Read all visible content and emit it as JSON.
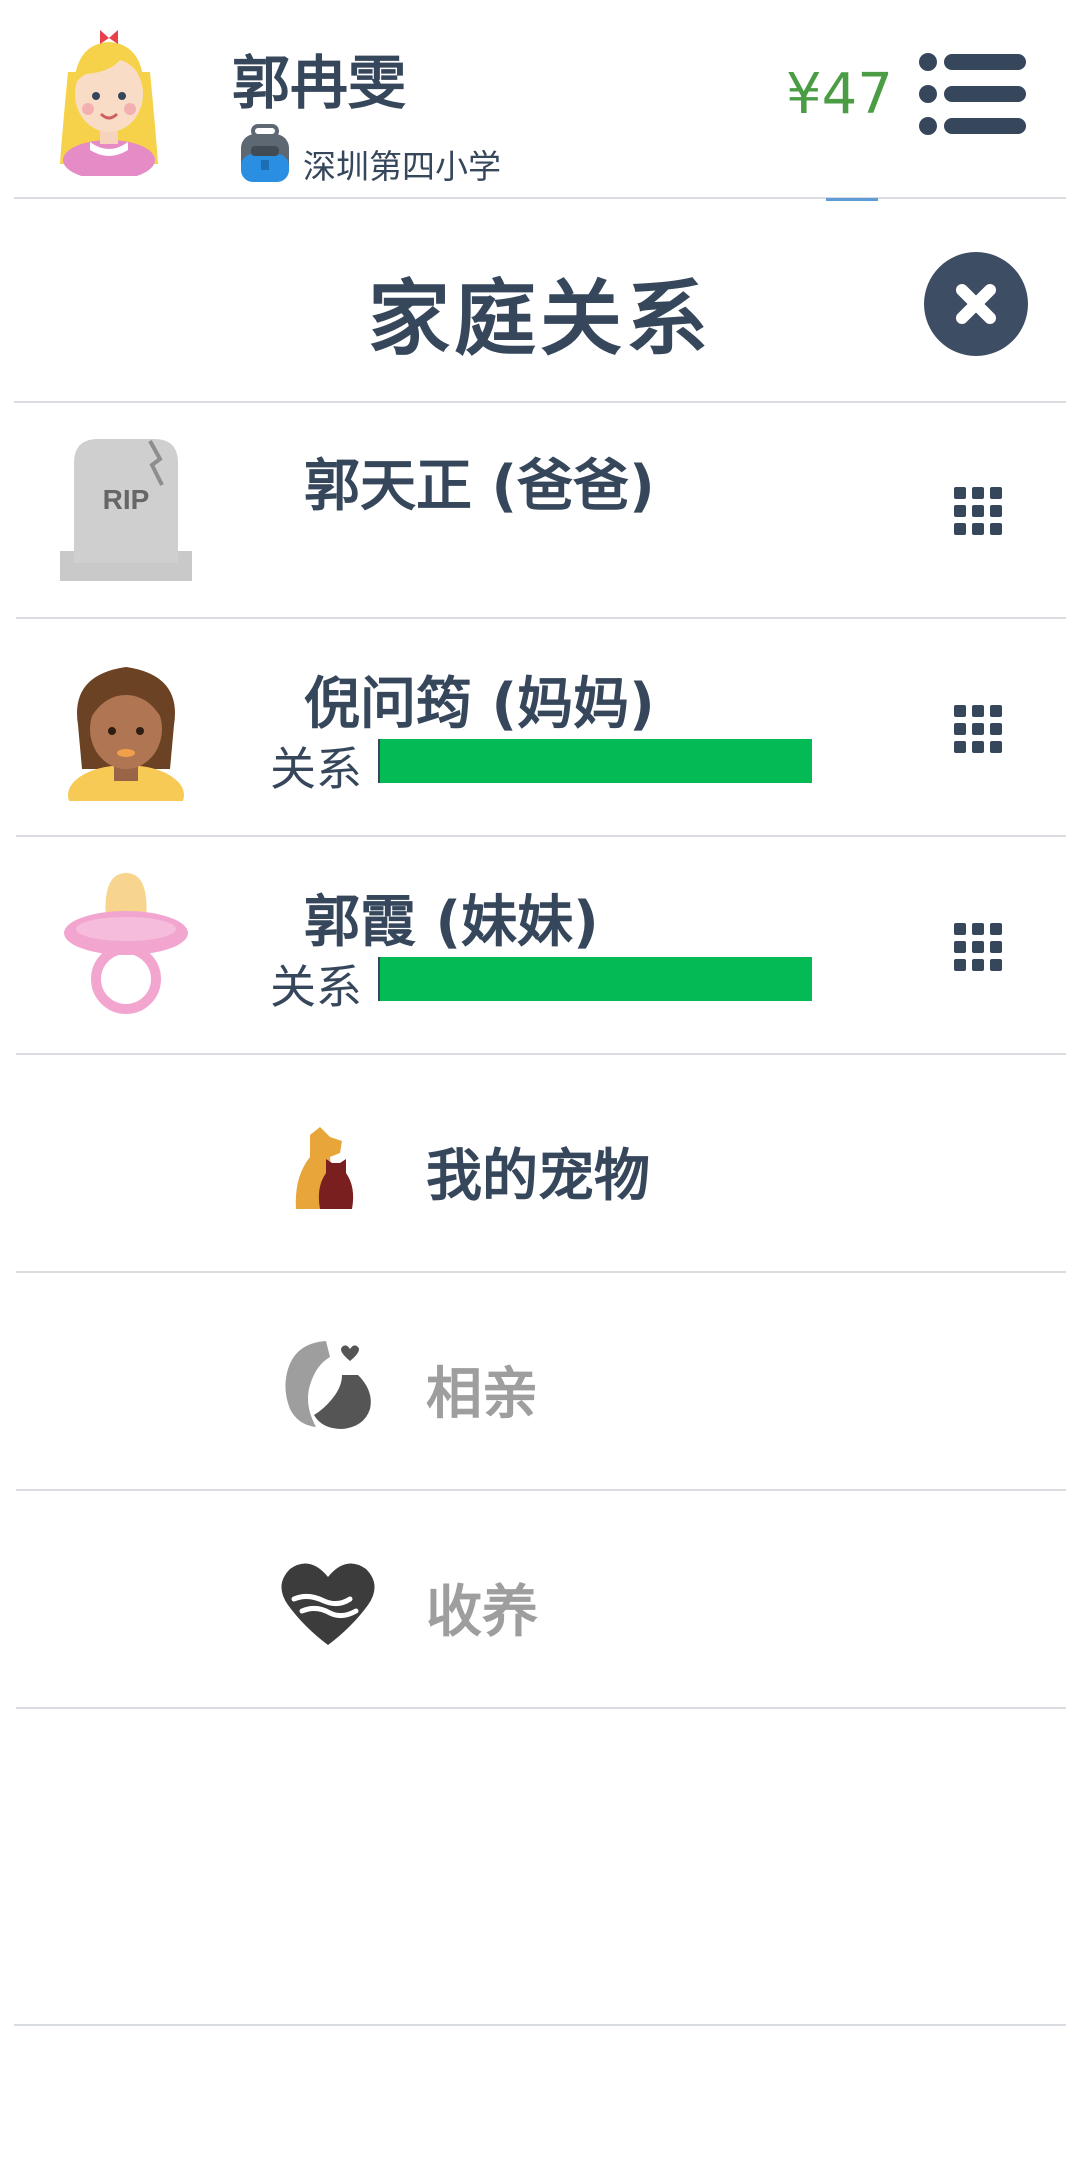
{
  "profile": {
    "name": "郭冉雯",
    "school": "深圳第四小学",
    "money": "¥47"
  },
  "page": {
    "title": "家庭关系"
  },
  "family": [
    {
      "name": "郭天正 (爸爸)",
      "avatar": "tombstone-icon",
      "tombstone_text": "RIP"
    },
    {
      "name": "倪问筠 (妈妈)",
      "avatar": "mother-avatar",
      "relation_label": "关系",
      "relation_level": 1.0
    },
    {
      "name": "郭霞 (妹妹)",
      "avatar": "pacifier-icon",
      "relation_label": "关系",
      "relation_level": 1.0
    }
  ],
  "actions": [
    {
      "label": "我的宠物",
      "icon": "pets-icon",
      "enabled": true
    },
    {
      "label": "相亲",
      "icon": "dating-icon",
      "enabled": false
    },
    {
      "label": "收养",
      "icon": "adoption-icon",
      "enabled": false
    }
  ],
  "colors": {
    "text": "#36475c",
    "money": "#4a9d44",
    "relation_bar": "#04ba55",
    "disabled_text": "#9e9e9e",
    "close_button": "#3d4d64"
  }
}
